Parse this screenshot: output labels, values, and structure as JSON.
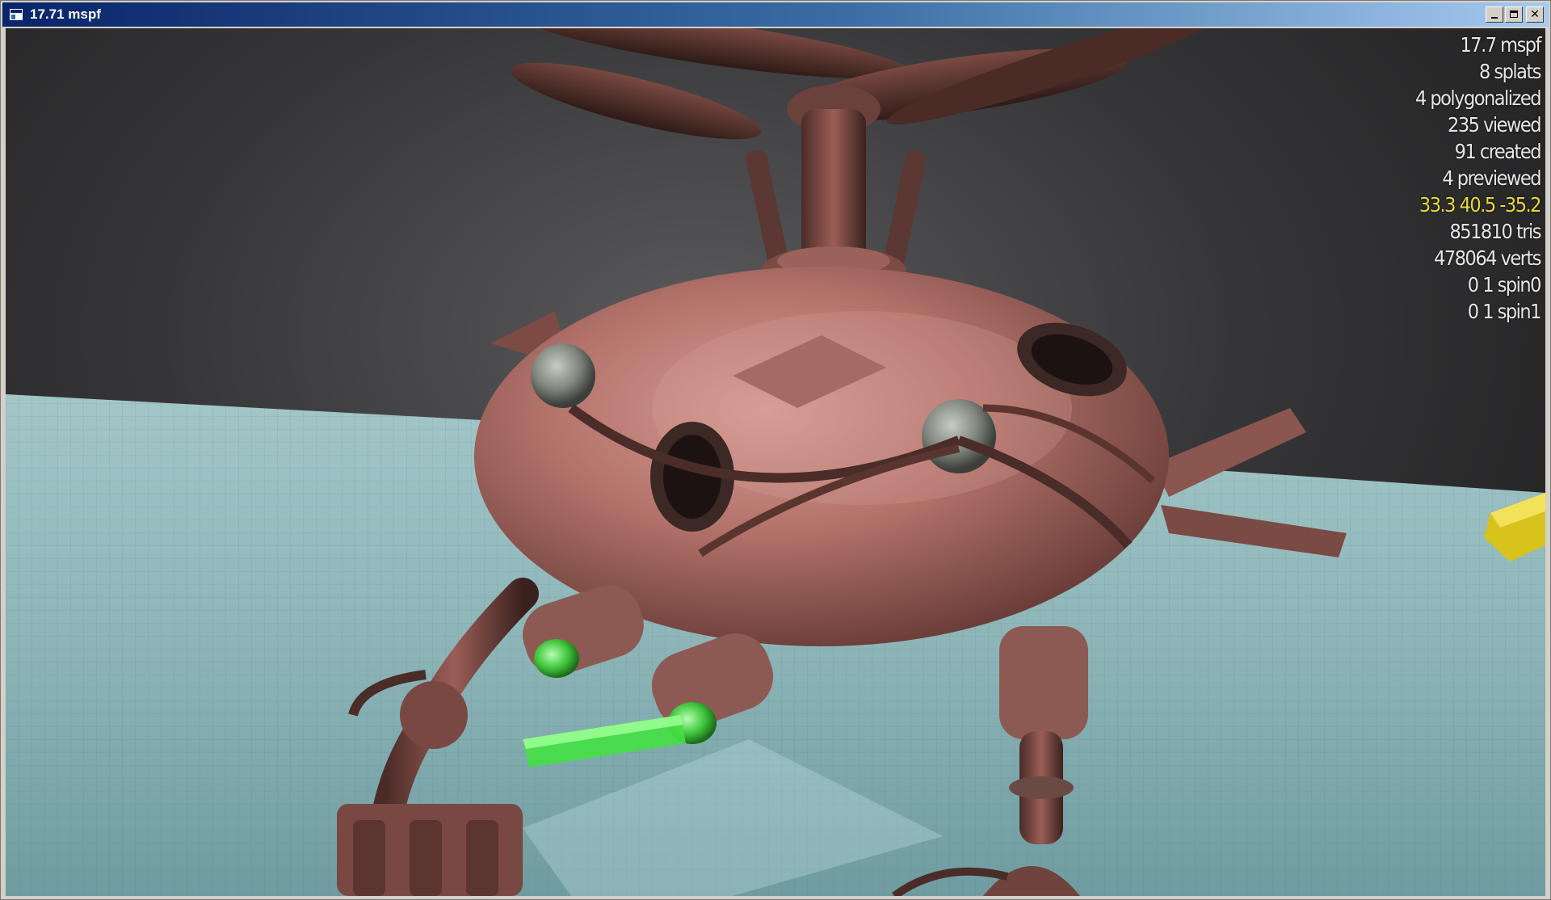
{
  "window": {
    "title": "17.71 mspf",
    "controls": {
      "minimize_icon": "minimize-icon",
      "maximize_icon": "maximize-icon",
      "close_icon": "close-icon",
      "close_glyph": "✕"
    }
  },
  "hud": {
    "lines": [
      {
        "text": "17.7 mspf",
        "color": "#e6e6e6"
      },
      {
        "text": "8 splats",
        "color": "#e6e6e6"
      },
      {
        "text": "4 polygonalized",
        "color": "#e6e6e6"
      },
      {
        "text": "235 viewed",
        "color": "#e6e6e6"
      },
      {
        "text": "91 created",
        "color": "#e6e6e6"
      },
      {
        "text": "4 previewed",
        "color": "#e6e6e6"
      },
      {
        "text": "33.3 40.5 -35.2",
        "color": "#e8d83a"
      },
      {
        "text": "851810 tris",
        "color": "#e6e6e6"
      },
      {
        "text": "478064 verts",
        "color": "#e6e6e6"
      },
      {
        "text": "0 1 spin0",
        "color": "#e6e6e6"
      },
      {
        "text": "0 1 spin1",
        "color": "#e6e6e6"
      }
    ]
  },
  "colors": {
    "titlebar_start": "#0a246a",
    "titlebar_end": "#a6caf0",
    "background_center": "#5a5a5c",
    "ground": "#8ab5b8",
    "robot_body": "#b0706a",
    "robot_dark": "#5a3530",
    "selection_highlight": "#44e044",
    "gizmo": "#e8d020"
  }
}
